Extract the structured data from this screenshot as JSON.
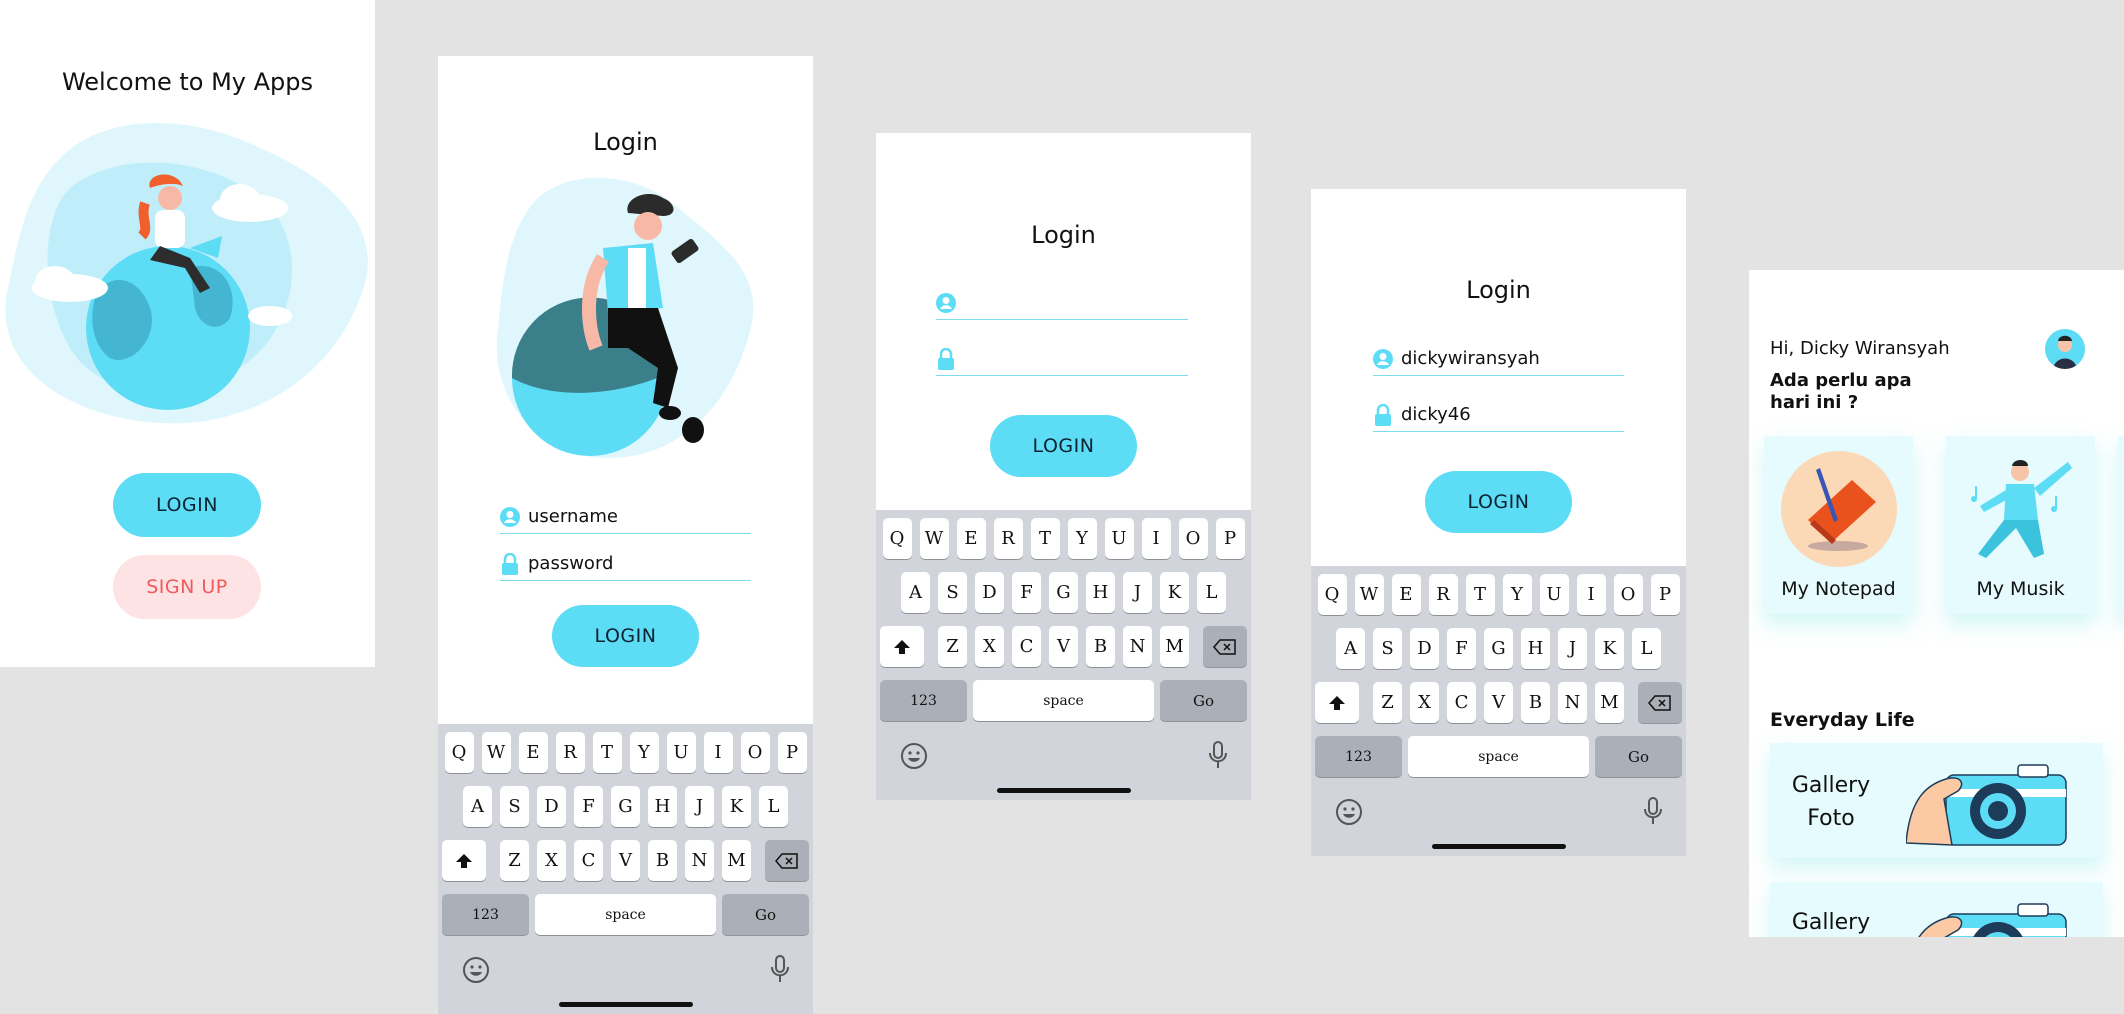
{
  "welcome": {
    "title": "Welcome to My Apps",
    "login_label": "LOGIN",
    "signup_label": "SIGN UP"
  },
  "login_screen_1": {
    "title": "Login",
    "username_value": "username",
    "password_value": "password",
    "login_label": "LOGIN"
  },
  "login_screen_2": {
    "title": "Login",
    "username_value": "",
    "password_value": "",
    "login_label": "LOGIN"
  },
  "login_screen_3": {
    "title": "Login",
    "username_value": "dickywiransyah",
    "password_value": "dicky46",
    "login_label": "LOGIN"
  },
  "keyboard": {
    "row1": [
      "Q",
      "W",
      "E",
      "R",
      "T",
      "Y",
      "U",
      "I",
      "O",
      "P"
    ],
    "row2": [
      "A",
      "S",
      "D",
      "F",
      "G",
      "H",
      "J",
      "K",
      "L"
    ],
    "row3": [
      "Z",
      "X",
      "C",
      "V",
      "B",
      "N",
      "M"
    ],
    "num_label": "123",
    "space_label": "space",
    "go_label": "Go"
  },
  "dashboard": {
    "greeting": "Hi, Dicky Wiransyah",
    "question_line1": "Ada perlu apa",
    "question_line2": "hari ini ?",
    "apps": [
      "My Notepad",
      "My Musik"
    ],
    "section_title": "Everyday Life",
    "gallery1_line1": "Gallery",
    "gallery1_line2": "Foto",
    "gallery2_line1": "Gallery"
  },
  "colors": {
    "accent": "#5ddcf6",
    "signup_bg": "#fde3e3",
    "signup_text": "#ef5a5a",
    "keyboard_bg": "#d1d4da",
    "canvas_bg": "#e3e3e3"
  },
  "icons": [
    "user-icon",
    "lock-icon",
    "shift-icon",
    "backspace-icon",
    "emoji-icon",
    "mic-icon",
    "avatar"
  ]
}
